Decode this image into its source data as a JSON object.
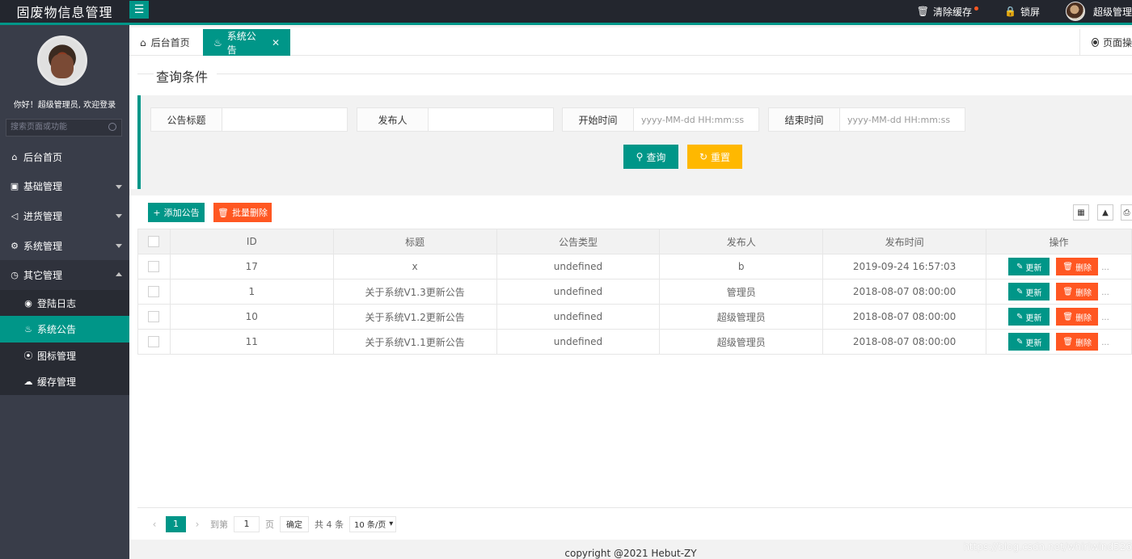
{
  "app": {
    "title": "固废物信息管理",
    "menu_toggle_icon": "menu-icon",
    "top_right": {
      "clear_cache": "清除缓存",
      "lock": "锁屏",
      "user": "超级管理"
    }
  },
  "sidebar": {
    "welcome": "你好！超级管理员, 欢迎登录",
    "search_placeholder": "搜索页面或功能",
    "items": [
      {
        "label": "后台首页",
        "icon": "home-icon"
      },
      {
        "label": "基础管理",
        "icon": "cube-icon"
      },
      {
        "label": "进货管理",
        "icon": "sound-icon"
      },
      {
        "label": "系统管理",
        "icon": "gear-icon"
      },
      {
        "label": "其它管理",
        "icon": "clock-icon"
      }
    ],
    "sub_items": [
      {
        "label": "登陆日志",
        "icon": "log-icon"
      },
      {
        "label": "系统公告",
        "icon": "fire-icon"
      },
      {
        "label": "图标管理",
        "icon": "compass-icon"
      },
      {
        "label": "缓存管理",
        "icon": "cloud-icon"
      }
    ]
  },
  "tabs": {
    "home": "后台首页",
    "active": "系统公告",
    "page_op": "页面操"
  },
  "query": {
    "legend": "查询条件",
    "fields": [
      {
        "label": "公告标题",
        "placeholder": ""
      },
      {
        "label": "发布人",
        "placeholder": ""
      },
      {
        "label": "开始时间",
        "placeholder": "yyyy-MM-dd HH:mm:ss"
      },
      {
        "label": "结束时间",
        "placeholder": "yyyy-MM-dd HH:mm:ss"
      }
    ],
    "search_button": "查询",
    "reset_button": "重置"
  },
  "toolbar": {
    "add": "添加公告",
    "batch_delete": "批量删除"
  },
  "table": {
    "headers": [
      "ID",
      "标题",
      "公告类型",
      "发布人",
      "发布时间",
      "操作"
    ],
    "rows": [
      {
        "id": "17",
        "title": "x",
        "type": "undefined",
        "publisher": "b",
        "time": "2019-09-24 16:57:03"
      },
      {
        "id": "1",
        "title": "关于系统V1.3更新公告",
        "type": "undefined",
        "publisher": "管理员",
        "time": "2018-08-07 08:00:00"
      },
      {
        "id": "10",
        "title": "关于系统V1.2更新公告",
        "type": "undefined",
        "publisher": "超级管理员",
        "time": "2018-08-07 08:00:00"
      },
      {
        "id": "11",
        "title": "关于系统V1.1更新公告",
        "type": "undefined",
        "publisher": "超级管理员",
        "time": "2018-08-07 08:00:00"
      }
    ],
    "update_label": "更新",
    "delete_label": "删除"
  },
  "pager": {
    "current": "1",
    "goto": "到第",
    "page_input": "1",
    "page_unit": "页",
    "confirm": "确定",
    "total": "共 4 条",
    "page_size": "10 条/页"
  },
  "footer": {
    "copyright": "copyright @2021 Hebut-ZY",
    "watermark": "https://blog.csdn.net/whirlwind526"
  },
  "colors": {
    "primary": "#009688",
    "warning": "#ffb800",
    "danger": "#ff5722",
    "header": "#23262e",
    "sidebar": "#393d49"
  }
}
